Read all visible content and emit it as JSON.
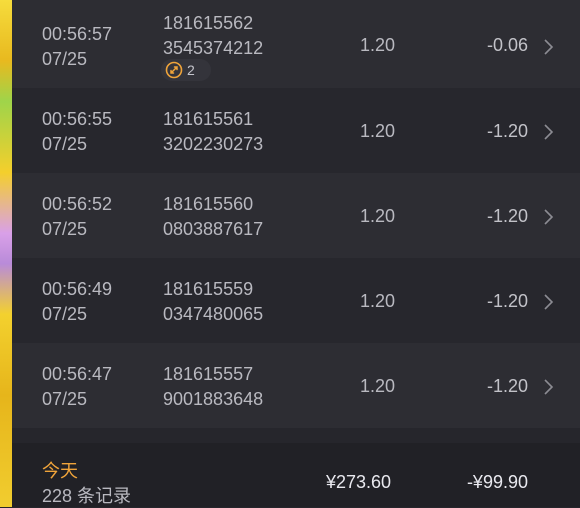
{
  "rows": [
    {
      "time": "00:56:57",
      "date": "07/25",
      "id_top": "181615562",
      "id_bottom": "3545374212",
      "amount": "1.20",
      "net": "-0.06",
      "badge_count": "2"
    },
    {
      "time": "00:56:55",
      "date": "07/25",
      "id_top": "181615561",
      "id_bottom": "3202230273",
      "amount": "1.20",
      "net": "-1.20"
    },
    {
      "time": "00:56:52",
      "date": "07/25",
      "id_top": "181615560",
      "id_bottom": "0803887617",
      "amount": "1.20",
      "net": "-1.20"
    },
    {
      "time": "00:56:49",
      "date": "07/25",
      "id_top": "181615559",
      "id_bottom": "0347480065",
      "amount": "1.20",
      "net": "-1.20"
    },
    {
      "time": "00:56:47",
      "date": "07/25",
      "id_top": "181615557",
      "id_bottom": "9001883648",
      "amount": "1.20",
      "net": "-1.20"
    }
  ],
  "footer": {
    "today_label": "今天",
    "record_count": "228 条记录",
    "total": "¥273.60",
    "net_total": "-¥99.90"
  },
  "colors": {
    "accent": "#f0a43a",
    "background": "#26262c",
    "row_alt": "#2d2d33"
  },
  "icons": {
    "badge": "link-coin-icon",
    "row_action": "chevron-right-icon"
  }
}
